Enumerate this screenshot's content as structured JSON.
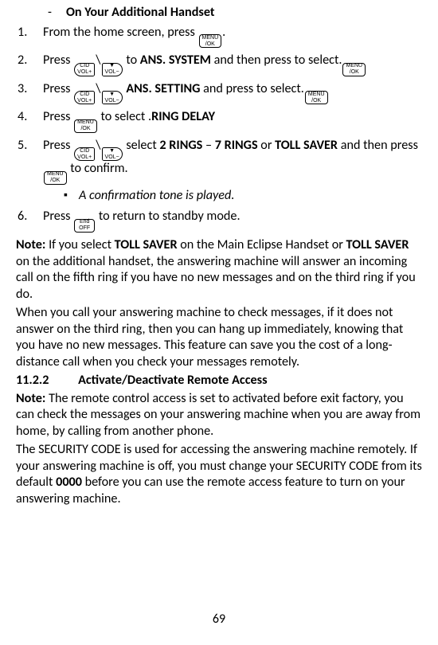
{
  "heading": "On Your Additional Handset",
  "keys": {
    "menu_ok": "MENU\n/OK",
    "vol_up": "CID\nVOL+",
    "vol_down": "▼\nVOL−",
    "end_off": "End\nOFF"
  },
  "steps": [
    {
      "pre": "From the home screen, press ",
      "keys1": [
        "menu_ok"
      ],
      "mid1": ".",
      "post": ""
    },
    {
      "pre": "Press ",
      "keys1": [
        "vol_up"
      ],
      "mid1": "\\",
      "keys2": [
        "vol_down"
      ],
      "mid2": " to ",
      "bold1": "ANS. SYSTEM",
      "mid3": " and then press ",
      "keys3": [
        "menu_ok"
      ],
      "mid4": " to select.",
      "post": ""
    },
    {
      "pre": "Press ",
      "keys1": [
        "vol_up"
      ],
      "mid1": "\\",
      "keys2": [
        "vol_down"
      ],
      "mid2": " ",
      "bold1": "ANS. SETTING",
      "mid3": " and press ",
      "keys3": [
        "menu_ok"
      ],
      "mid4": " to select.",
      "post": ""
    },
    {
      "pre": "Press ",
      "keys1": [
        "menu_ok"
      ],
      "mid1": " to select ",
      "bold1": "RING DELAY",
      "mid2": ".",
      "post": ""
    },
    {
      "pre": "Press ",
      "keys1": [
        "vol_up"
      ],
      "mid1": "\\",
      "keys2": [
        "vol_down"
      ],
      "mid2": " select ",
      "bold1": "2 RINGS",
      "mid3": " – ",
      "bold2": "7 RINGS",
      "mid4": " or ",
      "bold3": "TOLL SAVER",
      "mid5": " and then  press ",
      "keys3": [
        "menu_ok"
      ],
      "mid6": " to confirm.",
      "sub": "A confirmation tone is played."
    },
    {
      "pre": "Press ",
      "keys1": [
        "end_off"
      ],
      "mid1": " to return to standby mode.",
      "post": ""
    }
  ],
  "note1_label": "Note:",
  "note1_a": " If you select ",
  "note1_b1": "TOLL SAVER",
  "note1_c": " on the Main Eclipse Handset or ",
  "note1_b2": "TOLL SAVER",
  "note1_d": " on the additional handset, the answering machine will answer an incoming call on the fifth ring if you have no new messages and on the third ring if you do.",
  "note1_e": "When you call your answering machine to check messages, if it does not answer on the third ring, then you can hang up immediately, knowing that you have no new messages. This feature can save you the cost of a long-distance call when you check your messages remotely.",
  "sec_num": "11.2.2",
  "sec_title": "Activate/Deactivate Remote Access",
  "note2_label": "Note:",
  "note2_a": " The remote control access is set to activated before exit factory, you can check the messages on your answering machine when you are away from home, by calling from another phone.",
  "note2_b_pre": "The SECURITY CODE is used for accessing the answering machine remotely. If your answering machine is off, you must change your SECURITY CODE from its default ",
  "note2_b_bold": "0000",
  "note2_b_post": " before you can use the remote access feature to turn on your answering machine.",
  "page_number": "69"
}
